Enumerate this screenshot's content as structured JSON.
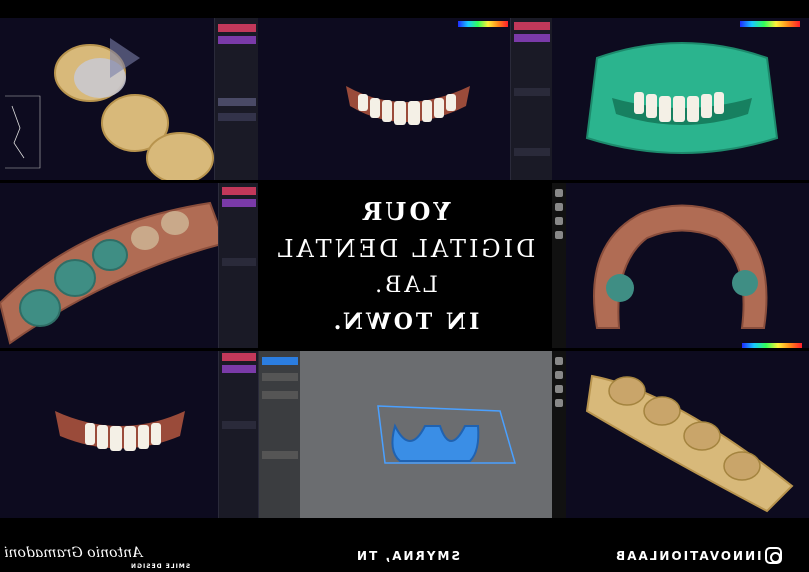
{
  "headline": {
    "line1": "YOUR",
    "line2": "DIGITAL DENTAL",
    "line3": "LAB.",
    "line4": "IN TOWN."
  },
  "footer": {
    "signature": "Antonio Gramadoni",
    "signature_sub": "SMILE DESIGN",
    "location": "SMYRNA, TN",
    "handle": "INNOVATIONLAAB"
  },
  "icons": [
    "instagram-icon",
    "toolbar-icon"
  ],
  "colors": {
    "panel_bg": "#0d0b1f",
    "gray_panel_bg": "#6b6d70",
    "gum": "#9a4b3a",
    "tooth": "#f4f0e6",
    "stone": "#d8b97a",
    "green_model": "#2bb48e",
    "blue_print": "#3a8ee6",
    "teal_prep": "#3f8e84"
  }
}
